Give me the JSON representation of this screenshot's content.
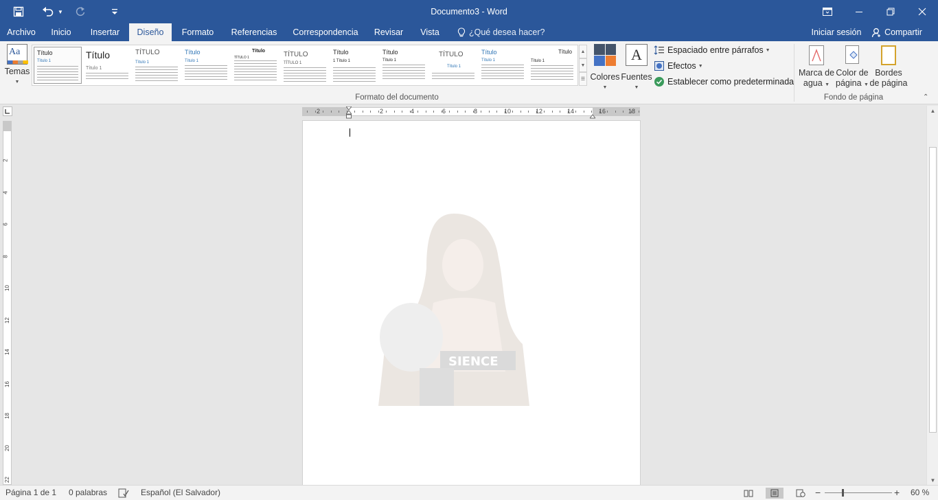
{
  "window": {
    "title": "Documento3 - Word",
    "accent": "#2b579a"
  },
  "quick_access": {
    "save_icon": "save-icon",
    "undo_icon": "undo-icon",
    "redo_icon": "redo-icon",
    "customize_icon": "customize-qat-icon"
  },
  "tabs": [
    {
      "label": "Archivo"
    },
    {
      "label": "Inicio"
    },
    {
      "label": "Insertar"
    },
    {
      "label": "Diseño",
      "active": true
    },
    {
      "label": "Formato"
    },
    {
      "label": "Referencias"
    },
    {
      "label": "Correspondencia"
    },
    {
      "label": "Revisar"
    },
    {
      "label": "Vista"
    }
  ],
  "tell_me": "¿Qué desea hacer?",
  "account": {
    "sign_in": "Iniciar sesión",
    "share": "Compartir"
  },
  "ribbon": {
    "themes_label": "Temas",
    "themes_sample": "Aa",
    "style_gallery": [
      {
        "title": "Título",
        "heading": "Título 1"
      },
      {
        "title": "Título",
        "heading": "Título 1"
      },
      {
        "title": "TÍTULO",
        "heading": "Título 1"
      },
      {
        "title": "Título",
        "heading": "Título 1"
      },
      {
        "title": "Título",
        "heading": "TÍTULO 1"
      },
      {
        "title": "TÍTULO",
        "heading": "TÍTULO 1"
      },
      {
        "title": "Título",
        "heading": "1 Título 1"
      },
      {
        "title": "Título",
        "heading": "Título 1"
      },
      {
        "title": "TÍTULO",
        "heading": "Título 1"
      },
      {
        "title": "Título",
        "heading": "Título 1"
      },
      {
        "title": "Título",
        "heading": "Título 1"
      }
    ],
    "colors_label": "Colores",
    "fonts_label": "Fuentes",
    "fonts_sample": "A",
    "paragraph_spacing": "Espaciado entre párrafos",
    "effects": "Efectos",
    "set_default": "Establecer como predeterminada",
    "format_group": "Formato del documento",
    "watermark_label": [
      "Marca de",
      "agua"
    ],
    "page_color_label": [
      "Color de",
      "página"
    ],
    "page_borders_label": [
      "Bordes",
      "de página"
    ],
    "background_group": "Fondo de página"
  },
  "ruler": {
    "horizontal": [
      "2",
      "2",
      "4",
      "6",
      "8",
      "10",
      "12",
      "14",
      "16",
      "18"
    ],
    "vertical": [
      "2",
      "4",
      "6",
      "8",
      "10",
      "12",
      "14",
      "16",
      "18",
      "20",
      "22"
    ]
  },
  "status": {
    "page": "Página 1 de 1",
    "words": "0 palabras",
    "language": "Español (El Salvador)",
    "zoom": "60 %"
  }
}
